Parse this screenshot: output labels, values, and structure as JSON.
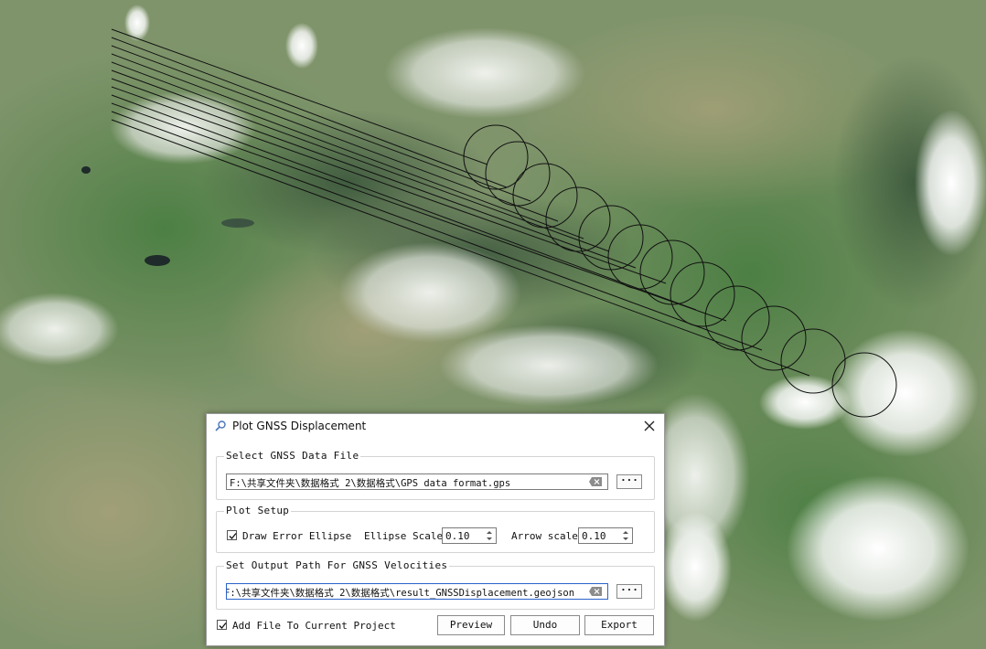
{
  "dialog": {
    "title": "Plot GNSS Displacement",
    "title_icon": "magnifier-icon",
    "close_icon": "close-icon",
    "data_group": {
      "label": "Select GNSS Data File",
      "path": "F:\\共享文件夹\\数据格式 2\\数据格式\\GPS data format.gps",
      "browse_label": "···"
    },
    "plot_group": {
      "label": "Plot Setup",
      "draw_error_ellipse_label": "Draw Error Ellipse",
      "draw_error_ellipse_checked": true,
      "ellipse_scale_label": "Ellipse Scale",
      "ellipse_scale_value": "0.10",
      "arrow_scale_label": "Arrow scale",
      "arrow_scale_value": "0.10"
    },
    "output_group": {
      "label": "Set Output Path For GNSS Velocities",
      "path": "F:\\共享文件夹\\数据格式 2\\数据格式\\result_GNSSDisplacement.geojson",
      "browse_label": "···"
    },
    "add_file_label": "Add File To Current Project",
    "add_file_checked": true,
    "buttons": {
      "preview": "Preview",
      "undo": "Undo",
      "export": "Export"
    }
  },
  "map": {
    "displacement_track_count": 12,
    "error_ellipse_count": 12
  }
}
